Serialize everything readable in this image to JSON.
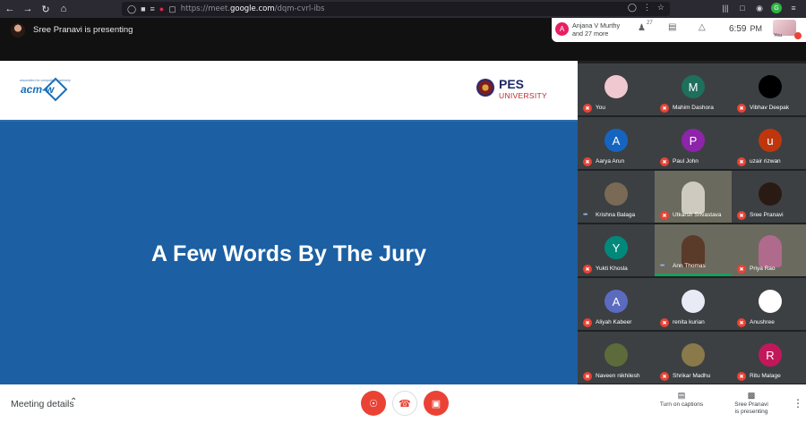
{
  "browser": {
    "url_prefix": "https://meet.",
    "url_domain": "google.com",
    "url_suffix": "/dqm-cvrl-ibs",
    "back_icon": "back-arrow-icon",
    "forward_icon": "forward-arrow-icon",
    "reload_icon": "reload-icon",
    "home_icon": "home-icon"
  },
  "meet_top": {
    "presenting_text": "Sree Pranavi is presenting",
    "attendee_initial": "A",
    "attendee_line1": "Anjana V Murthy",
    "attendee_line2": "and 27 more",
    "people_count": "27",
    "time": "6:59",
    "ampm": "PM",
    "you_label": "You"
  },
  "slide": {
    "acm_sub": "association for computing machinery",
    "acm_text": "acm-w",
    "pes_text": "PES",
    "pes_sub": "UNIVERSITY",
    "title": "A Few Words By The Jury"
  },
  "participants": [
    {
      "name": "You",
      "initial": "",
      "color": "#f0c8d0",
      "photo": true
    },
    {
      "name": "Mahim Dashora",
      "initial": "M",
      "color": "#1e6f5c"
    },
    {
      "name": "Vibhav Deepak",
      "initial": "",
      "color": "#000000",
      "photo": true
    },
    {
      "name": "Aarya Arun",
      "initial": "A",
      "color": "#1565c0"
    },
    {
      "name": "Paul John",
      "initial": "P",
      "color": "#8e24aa"
    },
    {
      "name": "uzair rizwan",
      "initial": "u",
      "color": "#bf360c"
    },
    {
      "name": "Krishna Balaga",
      "initial": "",
      "color": "#7a6a55",
      "photo": true,
      "speaking": true
    },
    {
      "name": "Utkarsh Srivastava",
      "initial": "",
      "color": "#cfcac0",
      "video": true
    },
    {
      "name": "Sree Pranavi",
      "initial": "",
      "color": "#2a1a14",
      "photo": true
    },
    {
      "name": "Yukti Khosla",
      "initial": "Y",
      "color": "#00897b"
    },
    {
      "name": "Ann Thomas",
      "initial": "",
      "color": "#5a3a28",
      "video": true,
      "speaking": true,
      "active": true
    },
    {
      "name": "Priya Rao",
      "initial": "",
      "color": "#b06a8c",
      "video": true
    },
    {
      "name": "Aliyah Kabeer",
      "initial": "A",
      "color": "#5c6bc0"
    },
    {
      "name": "renita kurian",
      "initial": "",
      "color": "#e8eaf6",
      "photo": true
    },
    {
      "name": "Anushree",
      "initial": "",
      "color": "#ffffff",
      "photo": true
    },
    {
      "name": "Naveen nikhilesh",
      "initial": "",
      "color": "#5d6b3a",
      "photo": true
    },
    {
      "name": "Shrikar Madhu",
      "initial": "",
      "color": "#8a7a4a",
      "photo": true
    },
    {
      "name": "Ritu Malage",
      "initial": "R",
      "color": "#c2185b"
    }
  ],
  "bottom": {
    "meeting_details": "Meeting details",
    "captions_line1": "Turn on captions",
    "present_line1": "Sree Pranavi",
    "present_line2": "is presenting"
  }
}
